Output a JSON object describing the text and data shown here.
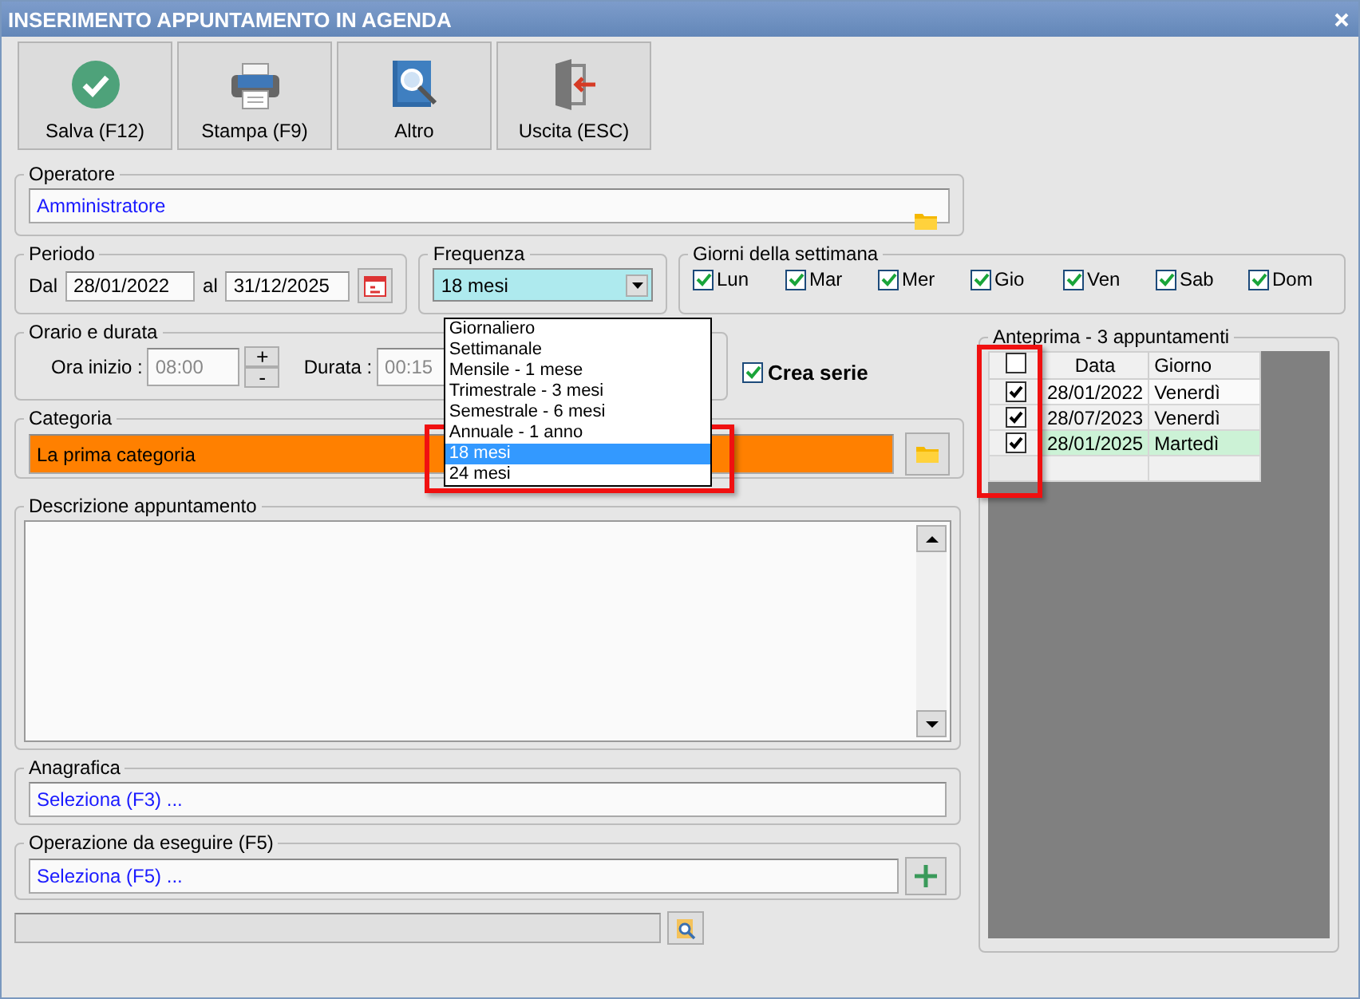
{
  "window": {
    "title": "INSERIMENTO APPUNTAMENTO IN AGENDA"
  },
  "toolbar": [
    {
      "kind": "save",
      "label": "Salva (F12)"
    },
    {
      "kind": "print",
      "label": "Stampa (F9)"
    },
    {
      "kind": "more",
      "label": "Altro"
    },
    {
      "kind": "exit",
      "label": "Uscita (ESC)"
    }
  ],
  "operatore": {
    "label": "Operatore",
    "value": "Amministratore"
  },
  "periodo": {
    "label": "Periodo",
    "from_label": "Dal",
    "from": "28/01/2022",
    "to_label": "al",
    "to": "31/12/2025"
  },
  "frequenza": {
    "label": "Frequenza",
    "value": "18 mesi",
    "expanded": true,
    "options": [
      {
        "label": "Giornaliero",
        "selected": false
      },
      {
        "label": "Settimanale",
        "selected": false
      },
      {
        "label": "Mensile - 1 mese",
        "selected": false
      },
      {
        "label": "Trimestrale - 3 mesi",
        "selected": false
      },
      {
        "label": "Semestrale - 6 mesi",
        "selected": false
      },
      {
        "label": "Annuale - 1 anno",
        "selected": false
      },
      {
        "label": "18 mesi",
        "selected": true
      },
      {
        "label": "24 mesi",
        "selected": false
      }
    ]
  },
  "giorni": {
    "label": "Giorni della settimana",
    "days": [
      {
        "label": "Lun",
        "checked": true
      },
      {
        "label": "Mar",
        "checked": true
      },
      {
        "label": "Mer",
        "checked": true
      },
      {
        "label": "Gio",
        "checked": true
      },
      {
        "label": "Ven",
        "checked": true
      },
      {
        "label": "Sab",
        "checked": true
      },
      {
        "label": "Dom",
        "checked": true
      }
    ]
  },
  "orario": {
    "label": "Orario e durata",
    "start_label": "Ora inizio :",
    "start": "08:00",
    "plus": "+",
    "minus": "-",
    "duration_label": "Durata :",
    "duration": "00:15"
  },
  "crea_serie": {
    "label": "Crea serie",
    "checked": true
  },
  "categoria": {
    "label": "Categoria",
    "value": "La prima categoria",
    "color": "#ff8000"
  },
  "descrizione": {
    "label": "Descrizione appuntamento"
  },
  "anagrafica": {
    "label": "Anagrafica",
    "value": "Seleziona (F3) ..."
  },
  "operazione": {
    "label": "Operazione da eseguire (F5)",
    "value": "Seleziona (F5) ..."
  },
  "anteprima": {
    "title": "Anteprima - 3 appuntamenti",
    "all_checked": false,
    "columns": [
      "Data",
      "Giorno"
    ],
    "rows": [
      {
        "checked": true,
        "date": "28/01/2022",
        "day": "Venerdì",
        "highlighted": false
      },
      {
        "checked": true,
        "date": "28/07/2023",
        "day": "Venerdì",
        "highlighted": false
      },
      {
        "checked": true,
        "date": "28/01/2025",
        "day": "Martedì",
        "highlighted": true
      }
    ]
  }
}
